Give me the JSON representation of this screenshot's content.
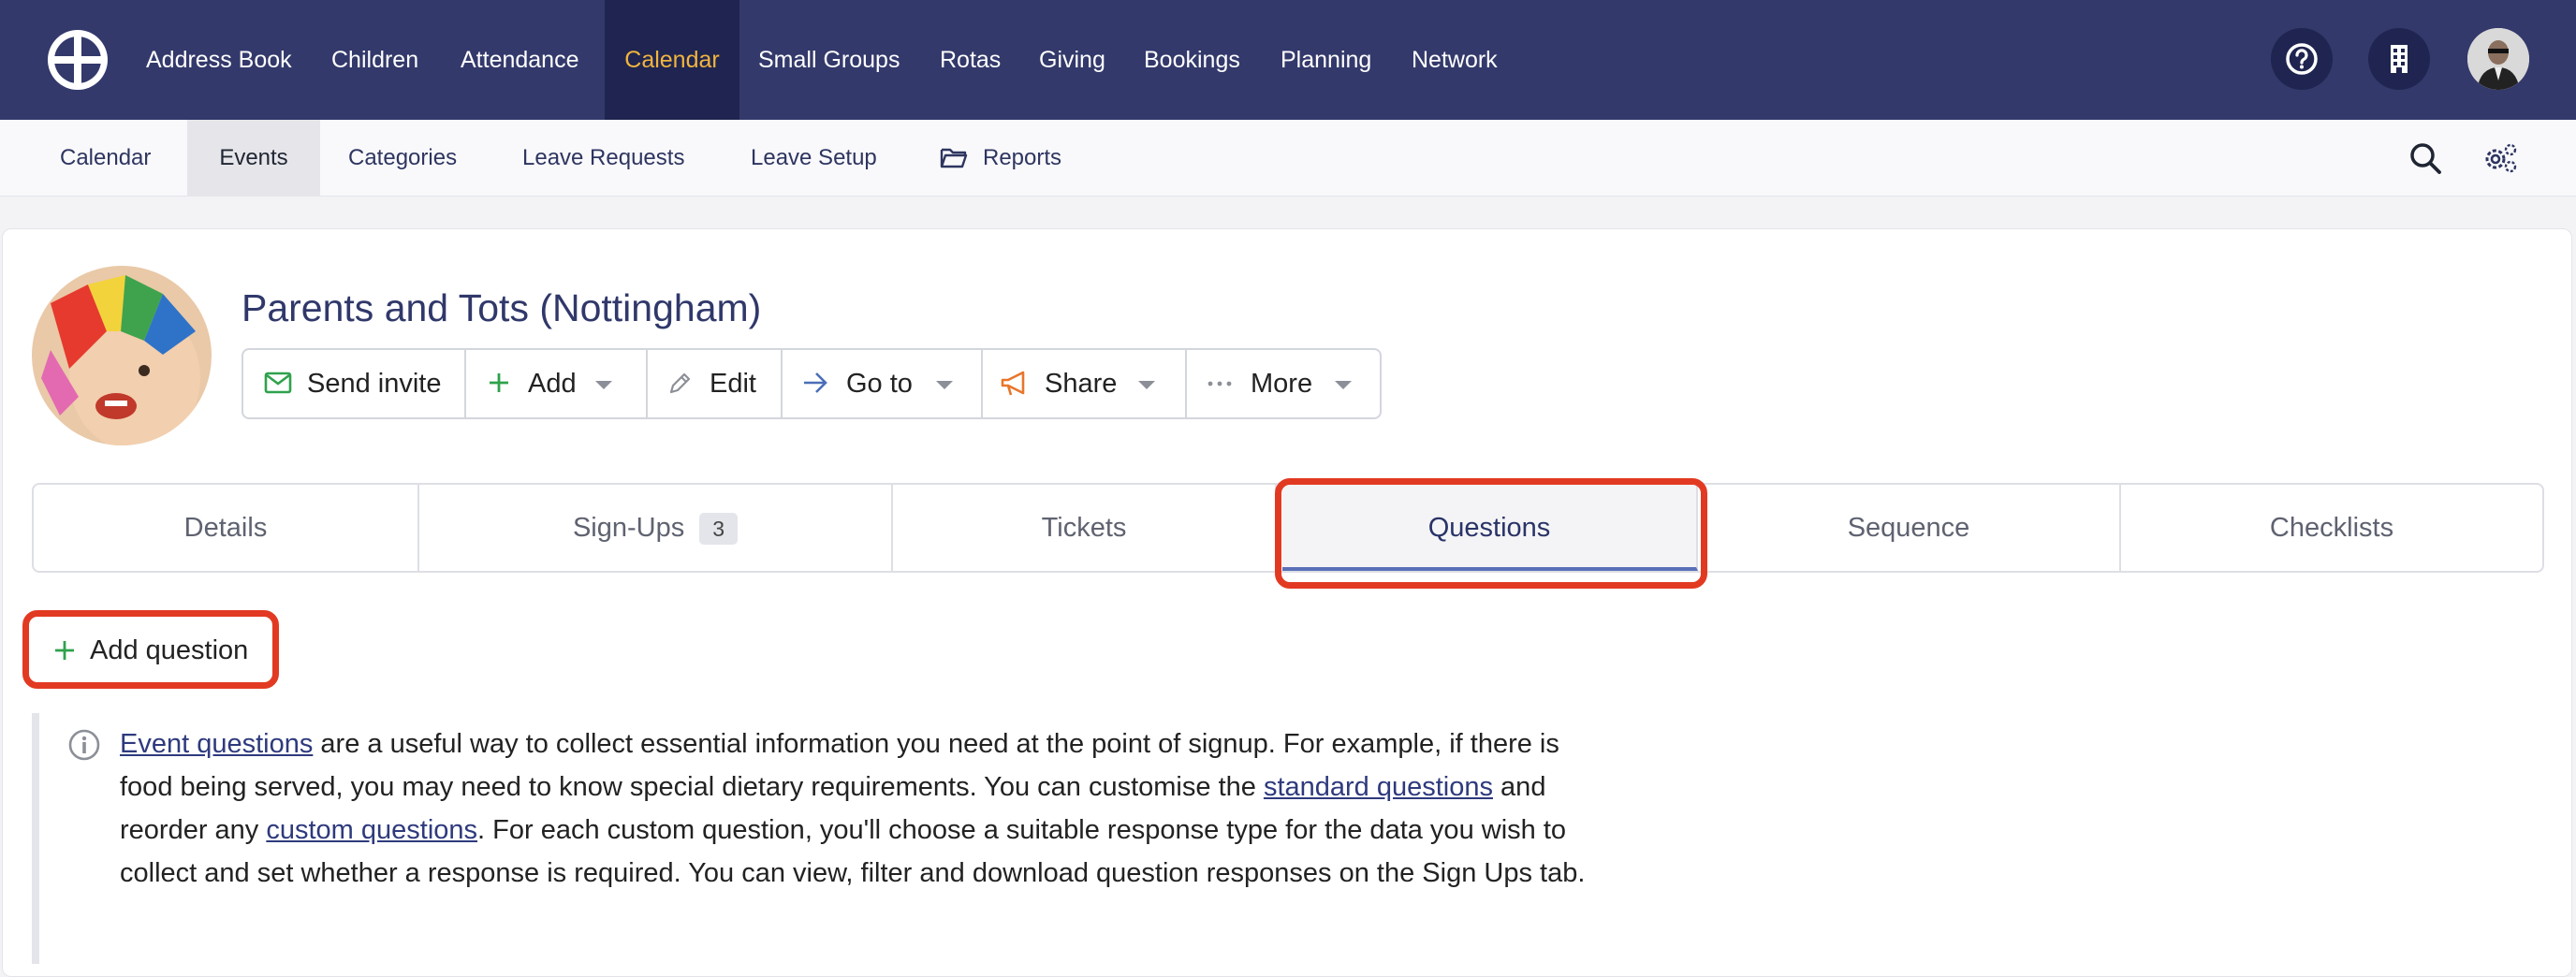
{
  "topnav": {
    "items": [
      "Address Book",
      "Children",
      "Attendance",
      "Calendar",
      "Small Groups",
      "Rotas",
      "Giving",
      "Bookings",
      "Planning",
      "Network"
    ],
    "active": "Calendar",
    "icons": [
      "help-icon",
      "building-icon",
      "user-avatar"
    ]
  },
  "subnav": {
    "items": [
      "Calendar",
      "Events",
      "Categories",
      "Leave Requests",
      "Leave Setup",
      "Reports"
    ],
    "active": "Events",
    "icons": [
      "folder-icon",
      "search-icon",
      "settings-icon"
    ]
  },
  "event": {
    "title": "Parents and Tots (Nottingham)"
  },
  "actions": {
    "send_invite": "Send invite",
    "add": "Add",
    "edit": "Edit",
    "goto": "Go to",
    "share": "Share",
    "more": "More"
  },
  "tabs": {
    "details": "Details",
    "signups": "Sign-Ups",
    "signups_count": "3",
    "tickets": "Tickets",
    "questions": "Questions",
    "sequence": "Sequence",
    "checklists": "Checklists",
    "active": "Questions"
  },
  "questions": {
    "add_label": "Add question",
    "info": {
      "link1": "Event questions",
      "text1": " are a useful way to collect essential information you need at the point of signup. For example, if there is food being served, you may need to know special dietary requirements. You can customise the ",
      "link2": "standard questions",
      "text2": " and reorder any ",
      "link3": "custom questions",
      "text3": ". For each custom question, you'll choose a suitable response type for the data you wish to collect and set whether a response is required. You can view, filter and download question responses on the Sign Ups tab."
    }
  },
  "colors": {
    "nav_bg": "#33396b",
    "nav_active_bg": "#1f2550",
    "nav_active_text": "#f1b43f",
    "highlight": "#e23a22",
    "tab_active_underline": "#5a6fb8"
  }
}
